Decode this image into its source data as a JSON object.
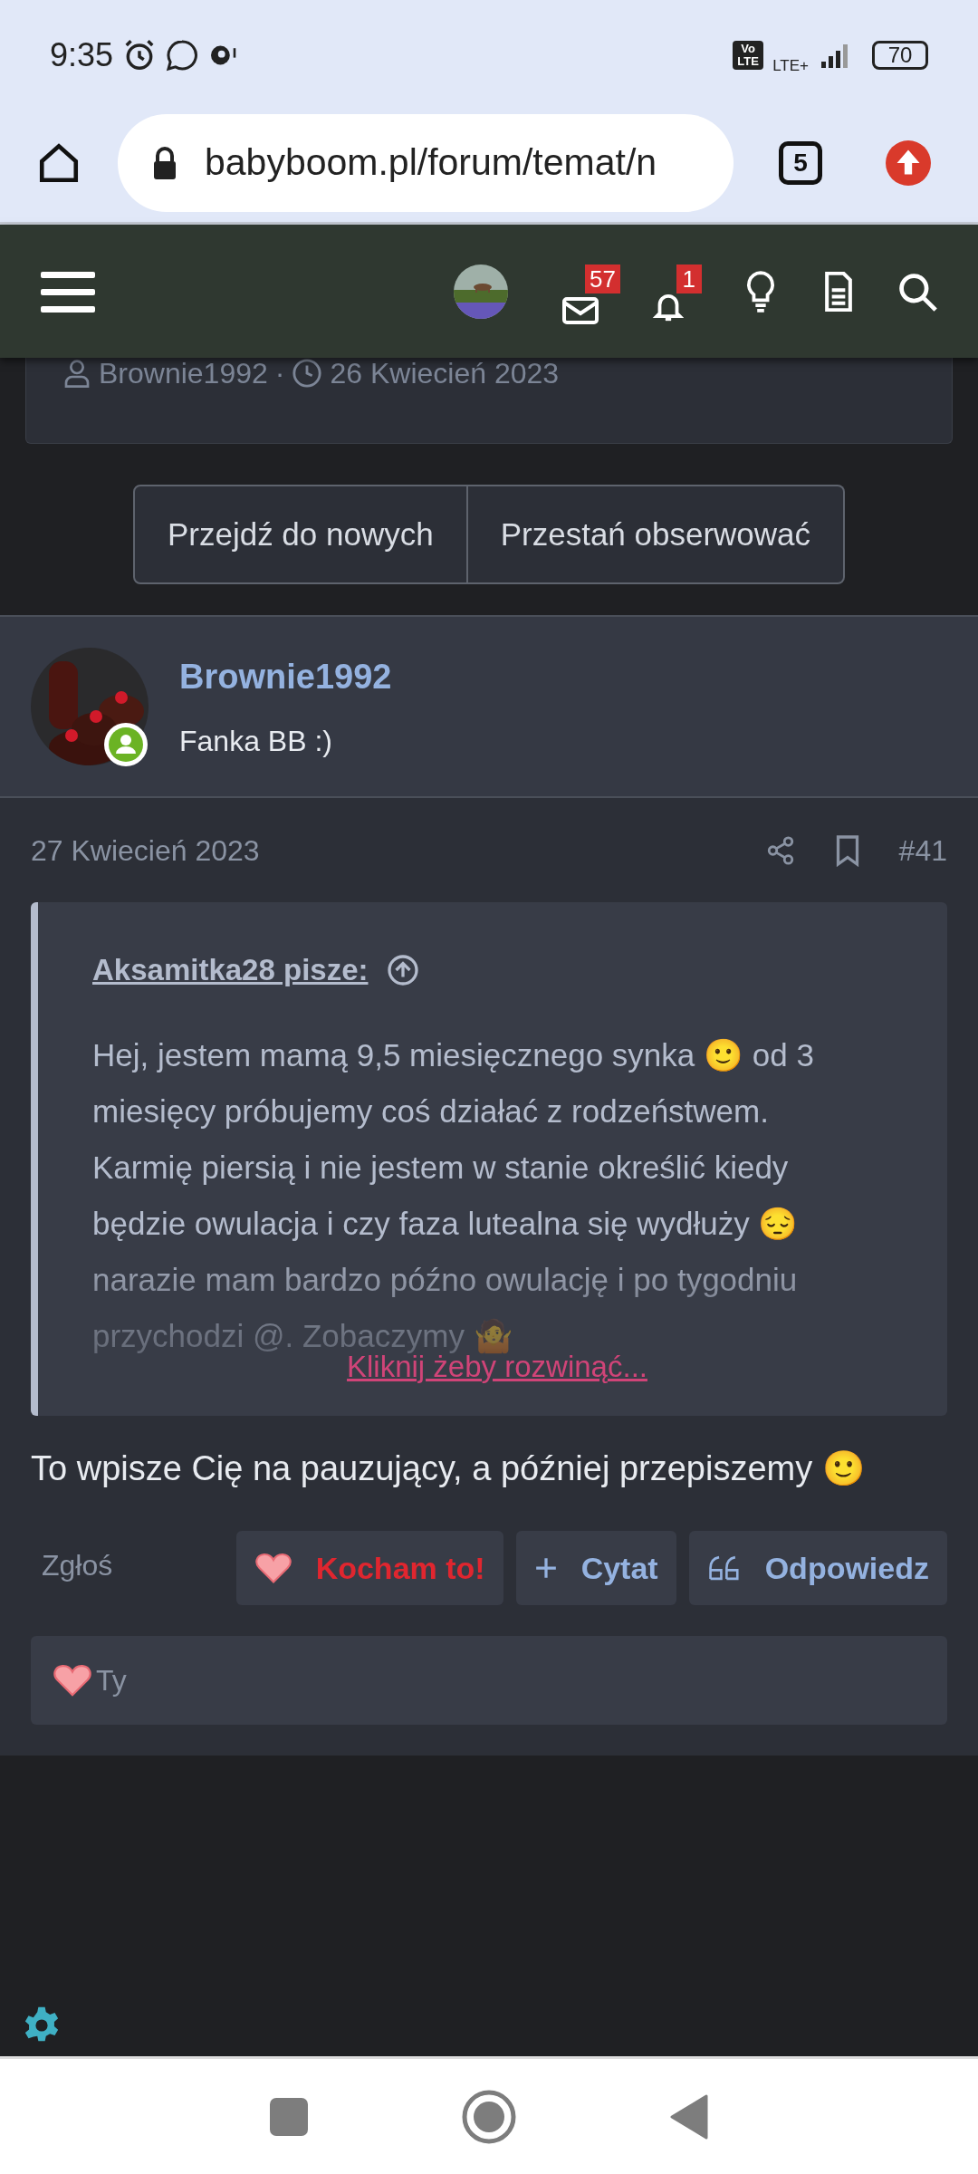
{
  "status_bar": {
    "time": "9:35",
    "volte": "Vo LTE",
    "network": "LTE+",
    "battery": "70"
  },
  "browser": {
    "url": "babyboom.pl/forum/temat/n",
    "tab_count": "5"
  },
  "forum_header": {
    "messages_badge": "57",
    "alerts_badge": "1"
  },
  "thread_info": {
    "author": "Brownie1992",
    "separator": "·",
    "date": "26 Kwiecień 2023"
  },
  "thread_buttons": [
    "Przejdź do nowych",
    "Przestań obserwować"
  ],
  "post": {
    "author": "Brownie1992",
    "user_title": "Fanka BB :)",
    "online": true,
    "date": "27 Kwiecień 2023",
    "number": "#41",
    "quote": {
      "author": "Aksamitka28 pisze:",
      "text": "Hej, jestem mamą 9,5 miesięcznego synka 🙂 od 3 miesięcy próbujemy coś działać z rodzeństwem. Karmię piersią i nie jestem w stanie określić kiedy będzie owulacja i czy faza lutealna się wydłuży 😔 narazie mam bardzo późno owulację i po tygodniu przychodzi @. Zobaczymy 🤷",
      "expand": "Kliknij żeby rozwinąć..."
    },
    "body": "To wpisze Cię na pauzujący, a później przepiszemy 🙂",
    "report": "Zgłoś",
    "actions": [
      {
        "kind": "like",
        "label": "Kocham to!",
        "selected": true
      },
      {
        "kind": "quote",
        "label": "Cytat"
      },
      {
        "kind": "reply",
        "label": "Odpowiedz"
      }
    ],
    "reactions": {
      "label": "Ty"
    }
  }
}
